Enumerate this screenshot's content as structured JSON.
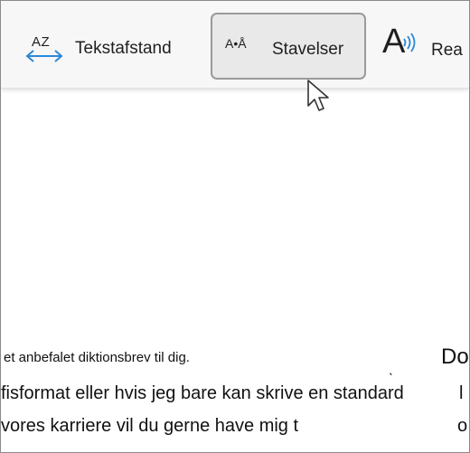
{
  "toolbar": {
    "spacing": {
      "icon_text": "AZ",
      "label": "Tekstafstand"
    },
    "syllables": {
      "icon_text": "A•Å",
      "label": "Stavelser"
    },
    "read_aloud": {
      "icon_text": "A",
      "label": "Rea"
    }
  },
  "document": {
    "lines": [
      "et anbefalet diktionsbrev til dig.",
      "fisformat eller hvis jeg bare kan skrive en standard",
      "vores karriere vil du gerne have mig t"
    ],
    "tick_mark": "ˎ",
    "right_column": [
      "Do",
      "l",
      "o"
    ]
  },
  "colors": {
    "accent_blue": "#2b88d8",
    "selected_bg": "#e9e9e9"
  }
}
